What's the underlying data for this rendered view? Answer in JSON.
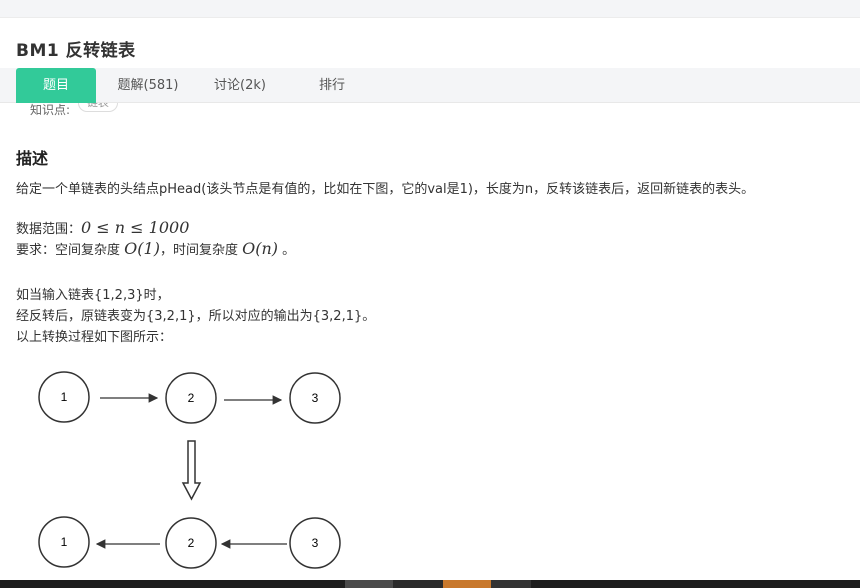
{
  "problem": {
    "title": "BM1  反转链表"
  },
  "tabs": [
    {
      "label": "题目"
    },
    {
      "label": "题解(581)"
    },
    {
      "label": "讨论(2k)"
    },
    {
      "label": "排行"
    }
  ],
  "knowledge": {
    "label": "知识点:",
    "tag": "链表"
  },
  "description": {
    "heading": "描述",
    "line1": "给定一个单链表的头结点pHead(该头节点是有值的，比如在下图，它的val是1)，长度为n，反转该链表后，返回新链表的表头。",
    "range_label": "数据范围：",
    "range_math": "0 ≤ n ≤ 1000",
    "req_label": "要求：空间复杂度",
    "space_math": "O(1)",
    "req_mid": "，时间复杂度",
    "time_math": "O(n)",
    "req_end": "。",
    "example1": "如当输入链表{1,2,3}时，",
    "example2": "经反转后，原链表变为{3,2,1}，所以对应的输出为{3,2,1}。",
    "example3": "以上转换过程如下图所示："
  },
  "diagram": {
    "top_nodes": [
      "1",
      "2",
      "3"
    ],
    "bottom_nodes": [
      "1",
      "2",
      "3"
    ]
  },
  "colors": {
    "accent": "#32ca99",
    "tabbar_bg": "#f4f5f7"
  }
}
